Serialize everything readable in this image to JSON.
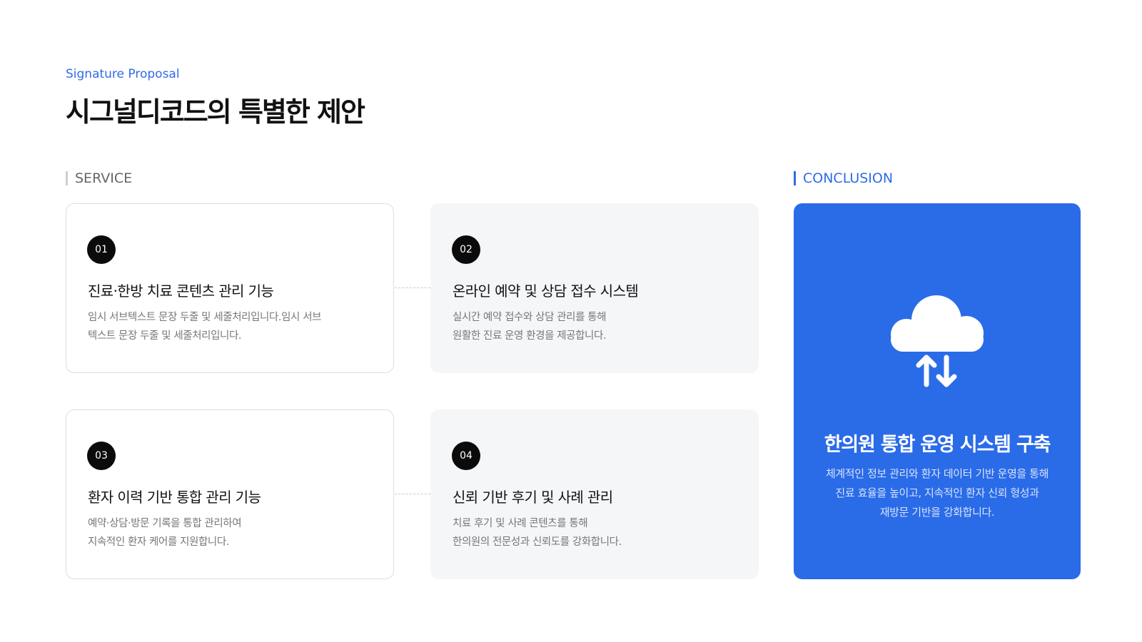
{
  "header": {
    "eyebrow": "Signature Proposal",
    "title": "시그널디코드의 특별한 제안"
  },
  "sections": {
    "service_label": "SERVICE",
    "conclusion_label": "CONCLUSION"
  },
  "services": [
    {
      "number": "01",
      "title": "진료·한방 치료 콘텐츠 관리 기능",
      "desc_line1": "임시 서브텍스트 문장 두줄 및 세줄처리입니다.임시 서브",
      "desc_line2": "텍스트 문장 두줄 및 세줄처리입니다."
    },
    {
      "number": "02",
      "title": "온라인 예약 및 상담 접수 시스템",
      "desc_line1": "실시간 예약 접수와 상담 관리를 통해",
      "desc_line2": "원활한 진료 운영 환경을 제공합니다."
    },
    {
      "number": "03",
      "title": "환자 이력 기반 통합 관리 기능",
      "desc_line1": "예약·상담·방문 기록을 통합 관리하여",
      "desc_line2": "지속적인 환자 케어를 지원합니다."
    },
    {
      "number": "04",
      "title": "신뢰 기반 후기 및 사례 관리",
      "desc_line1": "치료 후기 및 사례 콘텐츠를 통해",
      "desc_line2": "한의원의 전문성과 신뢰도를 강화합니다."
    }
  ],
  "conclusion": {
    "icon": "cloud-sync-icon",
    "title": "한의원 통합 운영 시스템 구축",
    "desc_line1": "체계적인 정보 관리와 환자 데이터 기반 운영을 통해",
    "desc_line2": "진료 효율을 높이고, 지속적인 환자 신뢰 형성과",
    "desc_line3": "재방문 기반을 강화합니다."
  },
  "colors": {
    "accent": "#2a6be8",
    "eyebrow": "#2f6ce5",
    "card_gray": "#f5f6f8",
    "number_badge": "#0b0b0b"
  }
}
